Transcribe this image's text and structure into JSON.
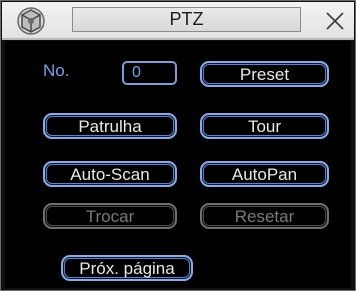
{
  "window": {
    "title": "PTZ",
    "logo_icon": "camera-logo-icon",
    "close_icon": "close-icon"
  },
  "controls": {
    "no_label": "No.",
    "no_value": "0",
    "preset": "Preset",
    "patrol": "Patrulha",
    "tour": "Tour",
    "auto_scan": "Auto-Scan",
    "auto_pan": "AutoPan",
    "switch": "Trocar",
    "reset": "Resetar",
    "next_page": "Próx. página"
  },
  "colors": {
    "accent": "#7b9cd8",
    "label_text": "#7aa0ea",
    "button_text": "#e8e8e8",
    "disabled_text": "#7a7a7a"
  }
}
